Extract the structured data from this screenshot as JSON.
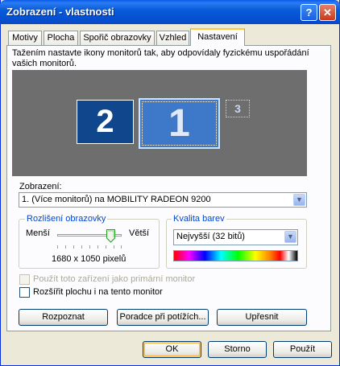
{
  "window": {
    "title": "Zobrazení - vlastnosti"
  },
  "tabs": [
    "Motivy",
    "Plocha",
    "Spořič obrazovky",
    "Vzhled",
    "Nastavení"
  ],
  "active_tab": "Nastavení",
  "instruction": "Tažením nastavte ikony monitorů tak, aby odpovídaly fyzickému uspořádání vašich monitorů.",
  "monitors": {
    "m1": "1",
    "m2": "2",
    "m3": "3"
  },
  "display": {
    "label": "Zobrazení:",
    "value": "1. (Více monitorů) na MOBILITY RADEON 9200"
  },
  "resolution": {
    "group_label": "Rozlišení obrazovky",
    "less": "Menší",
    "more": "Větší",
    "value": "1680 x 1050 pixelů"
  },
  "color": {
    "group_label": "Kvalita barev",
    "value": "Nejvyšší (32 bitů)"
  },
  "checkboxes": {
    "primary": "Použít toto zařízení jako primární monitor",
    "extend": "Rozšířit plochu i na tento monitor"
  },
  "buttons": {
    "identify": "Rozpoznat",
    "troubleshoot": "Poradce při potížích...",
    "advanced": "Upřesnit",
    "ok": "OK",
    "cancel": "Storno",
    "apply": "Použít"
  },
  "icons": {
    "help": "?",
    "close": "✕",
    "dropdown": "▼"
  }
}
